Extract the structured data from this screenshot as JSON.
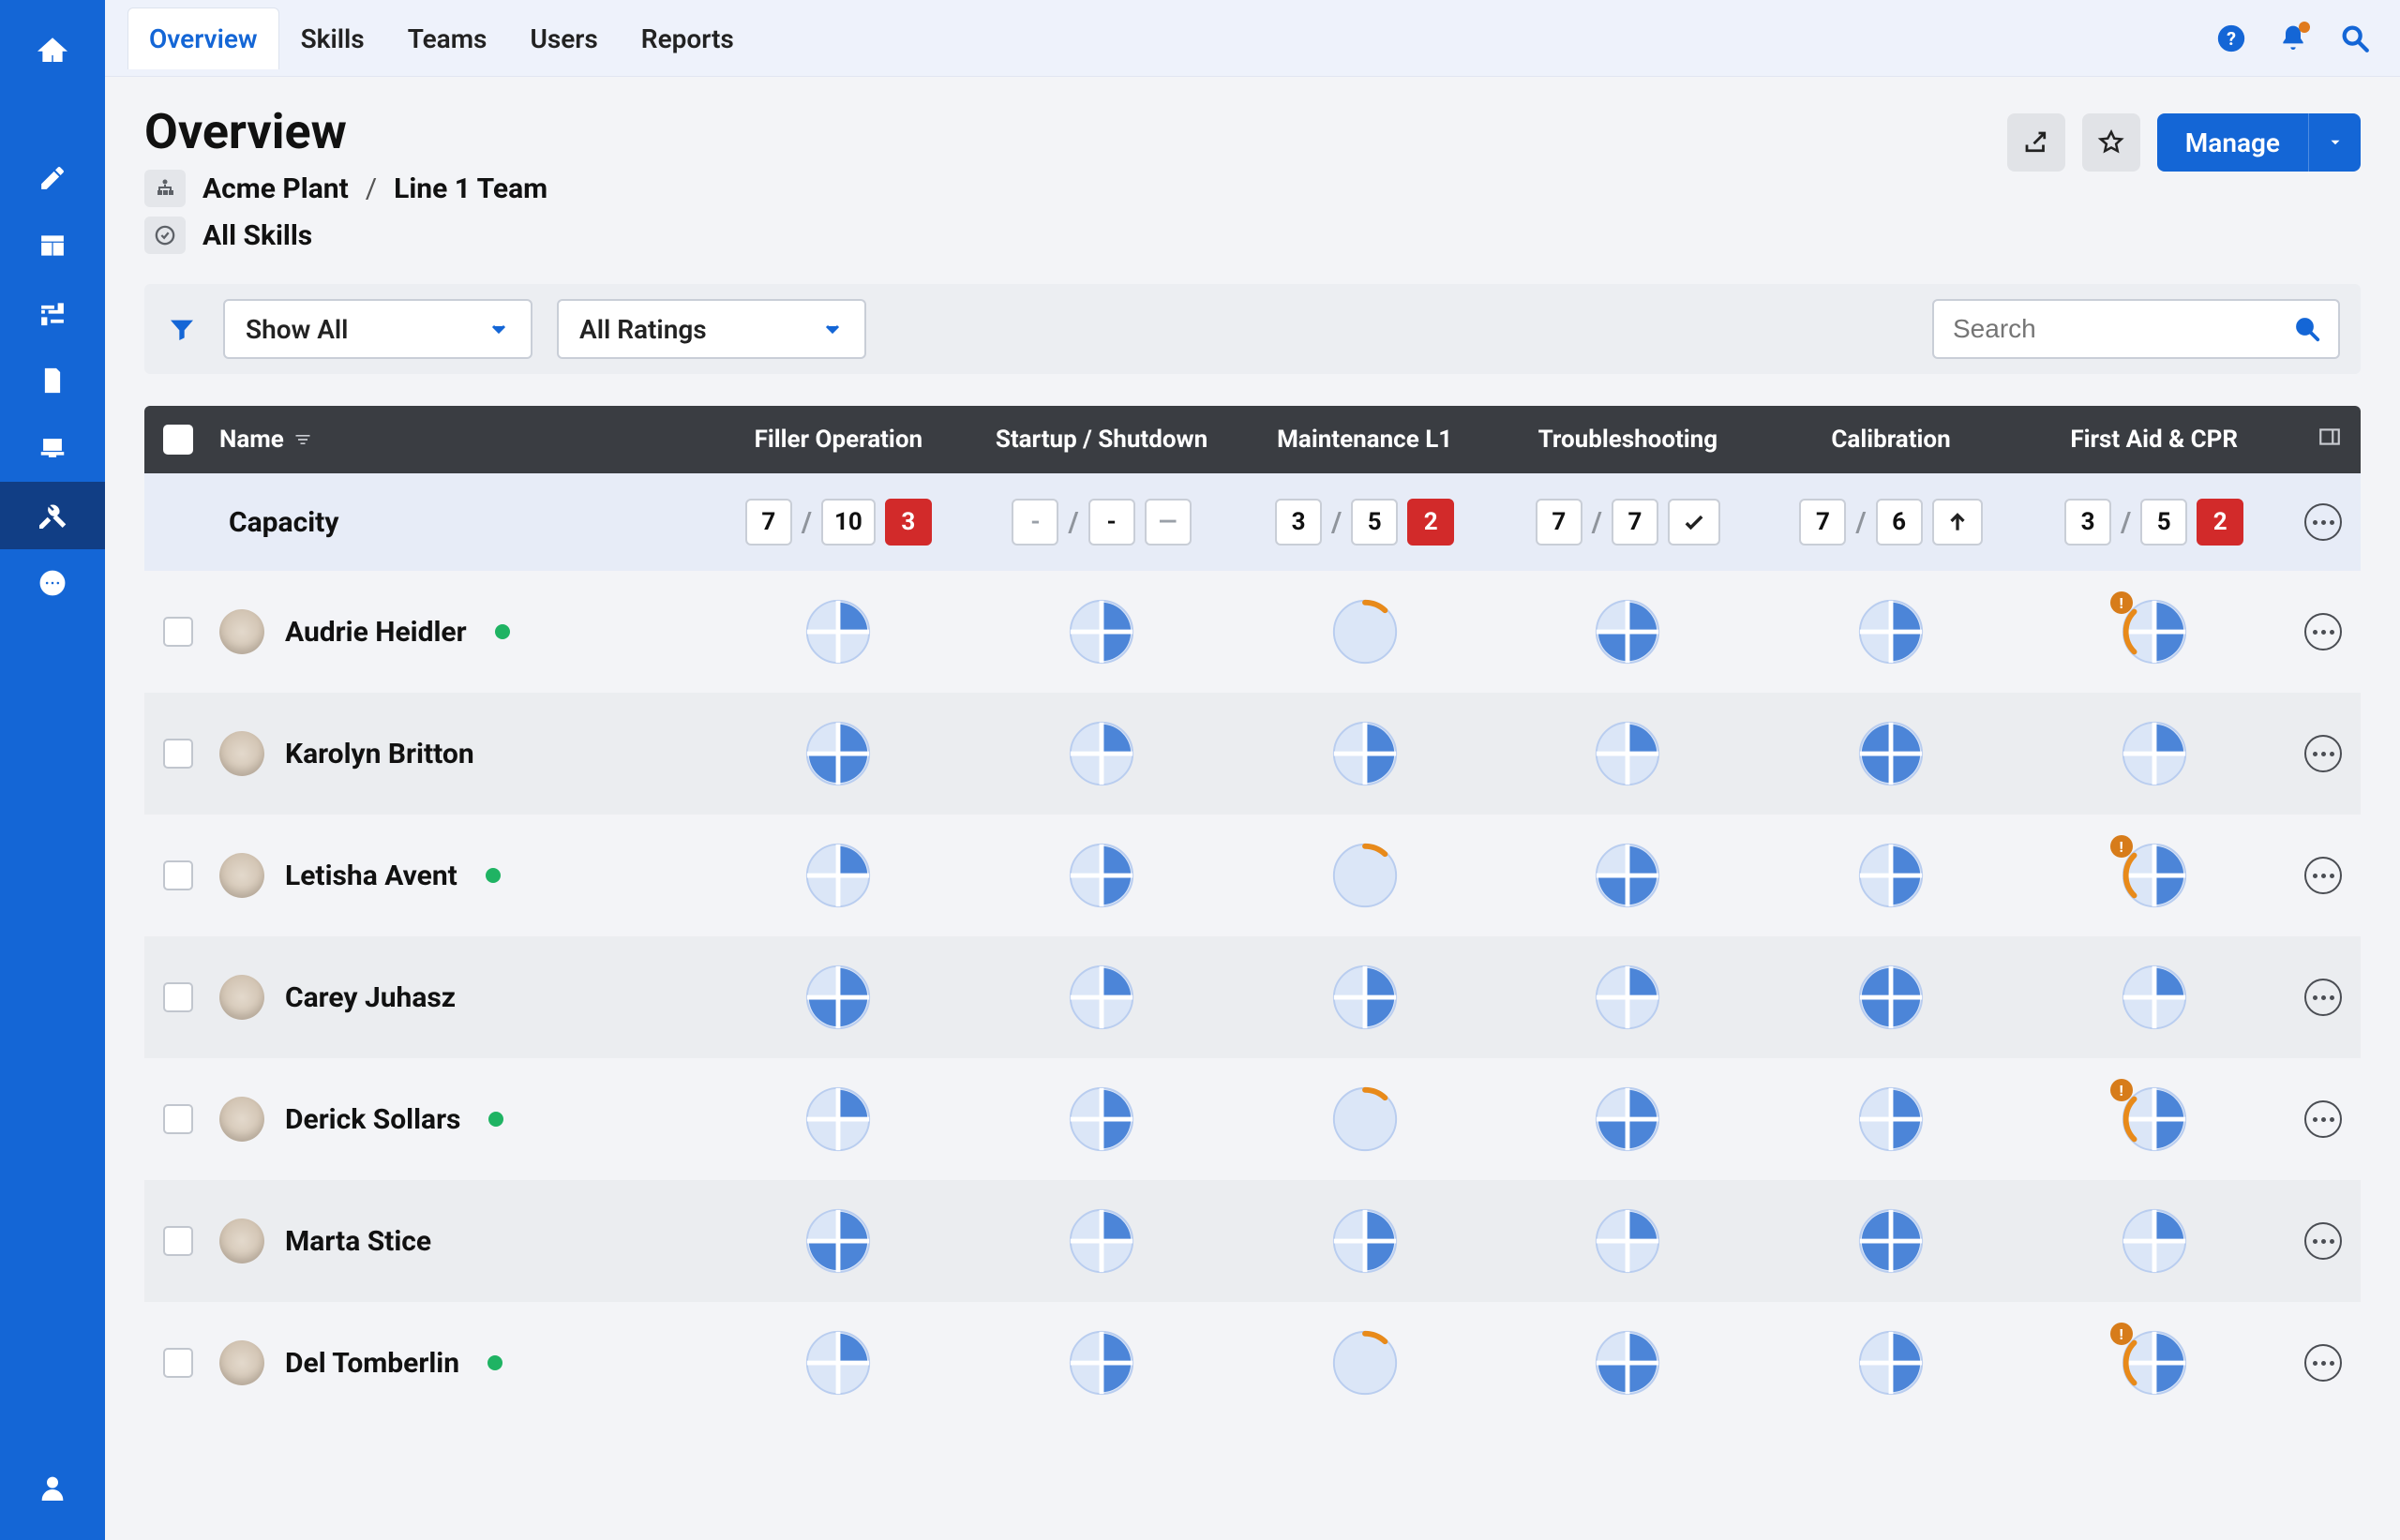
{
  "colors": {
    "blue": "#4c85d8",
    "blue_dark": "#2e6bbd",
    "pale": "#dbe6f7",
    "orange": "#e88a1a"
  },
  "tabs": [
    "Overview",
    "Skills",
    "Teams",
    "Users",
    "Reports"
  ],
  "active_tab": 0,
  "page_title": "Overview",
  "breadcrumb": {
    "org": "Acme Plant",
    "team": "Line 1 Team",
    "skill_filter": "All Skills"
  },
  "filters": {
    "show": "Show All",
    "ratings": "All Ratings"
  },
  "search": {
    "placeholder": "Search"
  },
  "manage_label": "Manage",
  "columns": [
    "Filler Operation",
    "Startup / Shutdown",
    "Maintenance L1",
    "Troubleshooting",
    "Calibration",
    "First Aid & CPR"
  ],
  "name_header": "Name",
  "capacity": {
    "label": "Capacity",
    "cols": [
      {
        "a": "7",
        "b": "10",
        "c": "3",
        "c_variant": "danger"
      },
      {
        "a": "-",
        "a_variant": "muted",
        "b": "-",
        "c": "—",
        "c_variant": "muted"
      },
      {
        "a": "3",
        "b": "5",
        "c": "2",
        "c_variant": "danger"
      },
      {
        "a": "7",
        "b": "7",
        "c_icon": "check"
      },
      {
        "a": "7",
        "b": "6",
        "c_icon": "up"
      },
      {
        "a": "3",
        "b": "5",
        "c": "2",
        "c_variant": "danger"
      }
    ]
  },
  "people": [
    {
      "name": "Audrie Heidler",
      "presence": true,
      "pies": [
        {
          "kind": "quads",
          "q": [
            1,
            0,
            0,
            0
          ]
        },
        {
          "kind": "quads",
          "q": [
            1,
            1,
            0,
            0
          ]
        },
        {
          "kind": "arc",
          "frac": 0.12
        },
        {
          "kind": "quads",
          "q": [
            1,
            1,
            1,
            0
          ]
        },
        {
          "kind": "quads",
          "q": [
            1,
            1,
            0,
            0
          ]
        },
        {
          "kind": "quads",
          "q": [
            1,
            1,
            0,
            0
          ],
          "arc": true,
          "badge": true
        }
      ]
    },
    {
      "name": "Karolyn Britton",
      "presence": false,
      "pies": [
        {
          "kind": "quads",
          "q": [
            1,
            1,
            1,
            0
          ]
        },
        {
          "kind": "quads",
          "q": [
            1,
            0,
            0,
            0
          ]
        },
        {
          "kind": "quads",
          "q": [
            1,
            1,
            0,
            0
          ]
        },
        {
          "kind": "quads",
          "q": [
            1,
            0,
            0,
            0
          ]
        },
        {
          "kind": "quads",
          "q": [
            1,
            1,
            1,
            1
          ]
        },
        {
          "kind": "quads",
          "q": [
            1,
            0,
            0,
            0
          ]
        }
      ]
    },
    {
      "name": "Letisha Avent",
      "presence": true,
      "pies": [
        {
          "kind": "quads",
          "q": [
            1,
            0,
            0,
            0
          ]
        },
        {
          "kind": "quads",
          "q": [
            1,
            1,
            0,
            0
          ]
        },
        {
          "kind": "arc",
          "frac": 0.12
        },
        {
          "kind": "quads",
          "q": [
            1,
            1,
            1,
            0
          ]
        },
        {
          "kind": "quads",
          "q": [
            1,
            1,
            0,
            0
          ]
        },
        {
          "kind": "quads",
          "q": [
            1,
            1,
            0,
            0
          ],
          "arc": true,
          "badge": true
        }
      ]
    },
    {
      "name": "Carey Juhasz",
      "presence": false,
      "pies": [
        {
          "kind": "quads",
          "q": [
            1,
            1,
            1,
            0
          ]
        },
        {
          "kind": "quads",
          "q": [
            1,
            0,
            0,
            0
          ]
        },
        {
          "kind": "quads",
          "q": [
            1,
            1,
            0,
            0
          ]
        },
        {
          "kind": "quads",
          "q": [
            1,
            0,
            0,
            0
          ]
        },
        {
          "kind": "quads",
          "q": [
            1,
            1,
            1,
            1
          ]
        },
        {
          "kind": "quads",
          "q": [
            1,
            0,
            0,
            0
          ]
        }
      ]
    },
    {
      "name": "Derick Sollars",
      "presence": true,
      "pies": [
        {
          "kind": "quads",
          "q": [
            1,
            0,
            0,
            0
          ]
        },
        {
          "kind": "quads",
          "q": [
            1,
            1,
            0,
            0
          ]
        },
        {
          "kind": "arc",
          "frac": 0.12
        },
        {
          "kind": "quads",
          "q": [
            1,
            1,
            1,
            0
          ]
        },
        {
          "kind": "quads",
          "q": [
            1,
            1,
            0,
            0
          ]
        },
        {
          "kind": "quads",
          "q": [
            1,
            1,
            0,
            0
          ],
          "arc": true,
          "badge": true
        }
      ]
    },
    {
      "name": "Marta Stice",
      "presence": false,
      "pies": [
        {
          "kind": "quads",
          "q": [
            1,
            1,
            1,
            0
          ]
        },
        {
          "kind": "quads",
          "q": [
            1,
            0,
            0,
            0
          ]
        },
        {
          "kind": "quads",
          "q": [
            1,
            1,
            0,
            0
          ]
        },
        {
          "kind": "quads",
          "q": [
            1,
            0,
            0,
            0
          ]
        },
        {
          "kind": "quads",
          "q": [
            1,
            1,
            1,
            1
          ]
        },
        {
          "kind": "quads",
          "q": [
            1,
            0,
            0,
            0
          ]
        }
      ]
    },
    {
      "name": "Del Tomberlin",
      "presence": true,
      "pies": [
        {
          "kind": "quads",
          "q": [
            1,
            0,
            0,
            0
          ]
        },
        {
          "kind": "quads",
          "q": [
            1,
            1,
            0,
            0
          ]
        },
        {
          "kind": "arc",
          "frac": 0.12
        },
        {
          "kind": "quads",
          "q": [
            1,
            1,
            1,
            0
          ]
        },
        {
          "kind": "quads",
          "q": [
            1,
            1,
            0,
            0
          ]
        },
        {
          "kind": "quads",
          "q": [
            1,
            1,
            0,
            0
          ],
          "arc": true,
          "badge": true
        }
      ]
    }
  ]
}
